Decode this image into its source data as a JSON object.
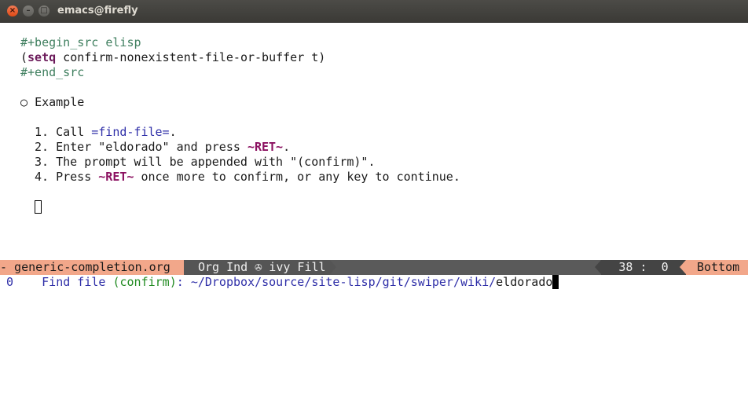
{
  "window": {
    "title": "emacs@firefly",
    "close_glyph": "×",
    "min_glyph": "–",
    "max_glyph": "□"
  },
  "buffer": {
    "src_begin": "#+begin_src elisp",
    "code_open_paren": "(",
    "code_keyword": "setq",
    "code_rest": " confirm-nonexistent-file-or-buffer t)",
    "src_end": "#+end_src",
    "heading_bullet": "○",
    "heading": "Example",
    "steps": [
      {
        "num": "1.",
        "pre": "Call ",
        "code": "=find-file=",
        "post": "."
      },
      {
        "num": "2.",
        "pre": "Enter \"eldorado\" and press ",
        "key": "~RET~",
        "post": "."
      },
      {
        "num": "3.",
        "pre": "The prompt will be appended with \"(confirm)\".",
        "post": ""
      },
      {
        "num": "4.",
        "pre": "Press ",
        "key": "~RET~",
        "post": " once more to confirm, or any key to continue."
      }
    ]
  },
  "modeline": {
    "file": "- generic-completion.org",
    "modes": "Org Ind ✇ ivy Fill",
    "position": "38 :  0",
    "scroll": "Bottom"
  },
  "minibuffer": {
    "count": "0",
    "prompt": "Find file ",
    "confirm": "(confirm)",
    "colon": ": ",
    "path": "~/Dropbox/source/site-lisp/git/swiper/wiki/",
    "input": "eldorado"
  },
  "colors": {
    "titlebar": "#3b3a36",
    "modeline_accent": "#f2a78a",
    "modeline_bg": "#5a5a5a",
    "keyword": "#6b1a5a",
    "meta": "#3f7f5f",
    "code": "#2f2fa8"
  }
}
